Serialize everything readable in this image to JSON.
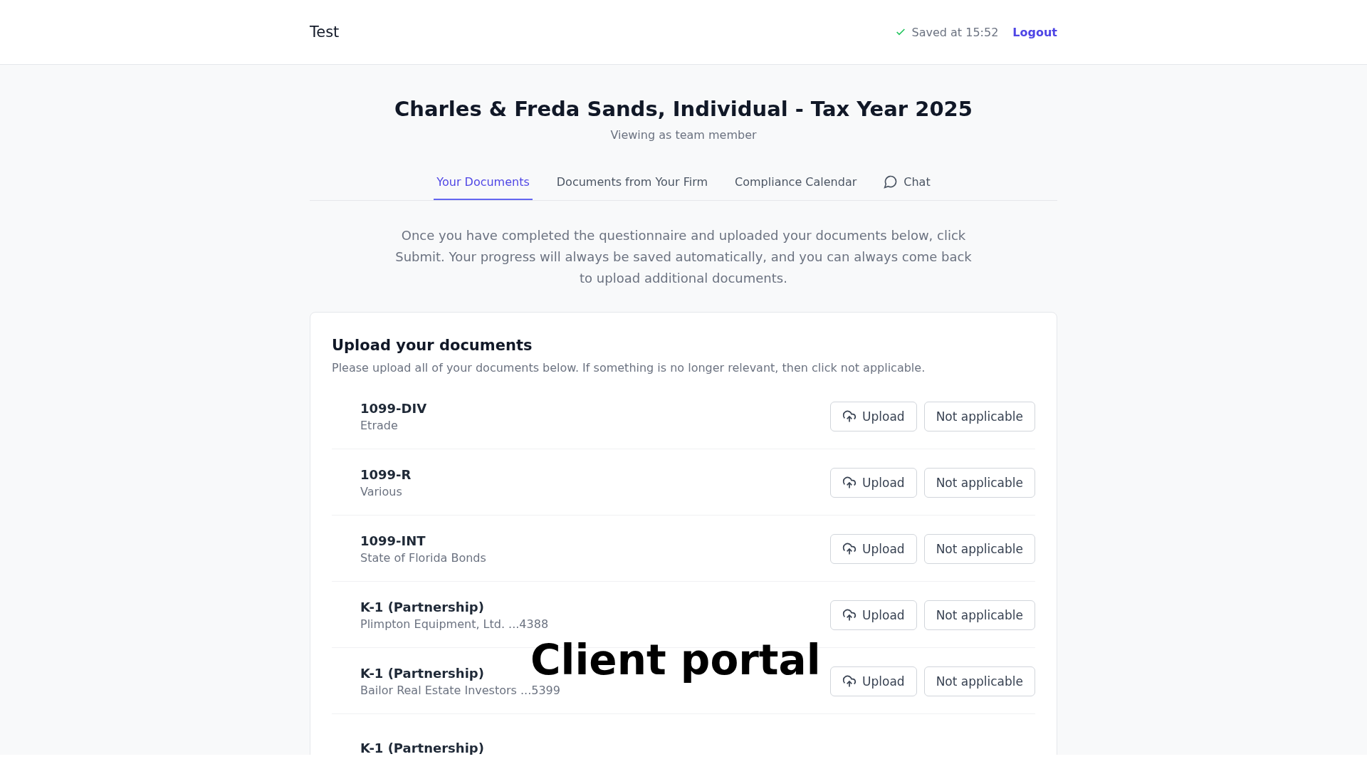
{
  "header": {
    "brand": "Test",
    "saved_status": "Saved at 15:52",
    "logout": "Logout"
  },
  "title": "Charles & Freda Sands, Individual - Tax Year 2025",
  "subtitle": "Viewing as team member",
  "tabs": [
    {
      "label": "Your Documents",
      "selected": true,
      "kind": "text"
    },
    {
      "label": "Documents from Your Firm",
      "selected": false,
      "kind": "text"
    },
    {
      "label": "Compliance Calendar",
      "selected": false,
      "kind": "text"
    },
    {
      "label": "Chat",
      "selected": false,
      "kind": "chat"
    }
  ],
  "intro": "Once you have completed the questionnaire and uploaded your documents below, click Submit. Your progress will always be saved automatically, and you can always come back to upload additional documents.",
  "upload_card": {
    "heading": "Upload your documents",
    "description": "Please upload all of your documents below. If something is no longer relevant, then click not applicable.",
    "documents": [
      {
        "name": "1099-DIV",
        "source": "Etrade",
        "upload": "Upload",
        "not_applicable": "Not applicable"
      },
      {
        "name": "1099-R",
        "source": "Various",
        "upload": "Upload",
        "not_applicable": "Not applicable"
      },
      {
        "name": "1099-INT",
        "source": "State of Florida Bonds",
        "upload": "Upload",
        "not_applicable": "Not applicable"
      },
      {
        "name": "K-1 (Partnership)",
        "source": "Plimpton Equipment, Ltd. ...4388",
        "upload": "Upload",
        "not_applicable": "Not applicable"
      },
      {
        "name": "K-1 (Partnership)",
        "source": "Bailor Real Estate Investors ...5399",
        "upload": "Upload",
        "not_applicable": "Not applicable"
      },
      {
        "name": "K-1 (Partnership)"
      }
    ]
  },
  "caption": "Client portal"
}
